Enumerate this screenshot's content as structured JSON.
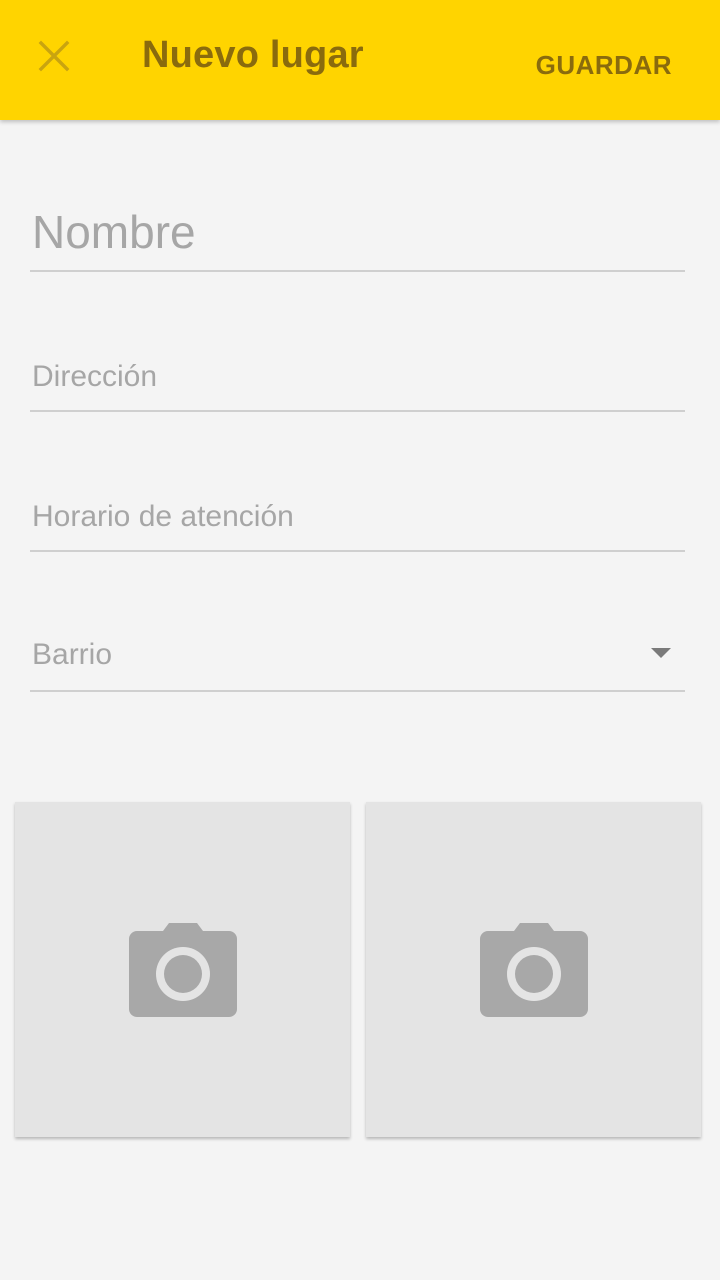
{
  "colors": {
    "toolbar_background": "#ffd400",
    "toolbar_text": "#8a6b0d",
    "page_background": "#f4f4f4",
    "photo_background": "#e4e4e4",
    "icon_gray": "#a8a8a8"
  },
  "toolbar": {
    "close_icon": "close-icon",
    "title": "Nuevo lugar",
    "save_label": "GUARDAR"
  },
  "form": {
    "nombre_placeholder": "Nombre",
    "direccion_placeholder": "Dirección",
    "horario_placeholder": "Horario de atención",
    "barrio_value": "Barrio",
    "barrio_icon": "dropdown-arrow-icon"
  },
  "photos": {
    "icon": "camera-icon",
    "count": 2
  }
}
